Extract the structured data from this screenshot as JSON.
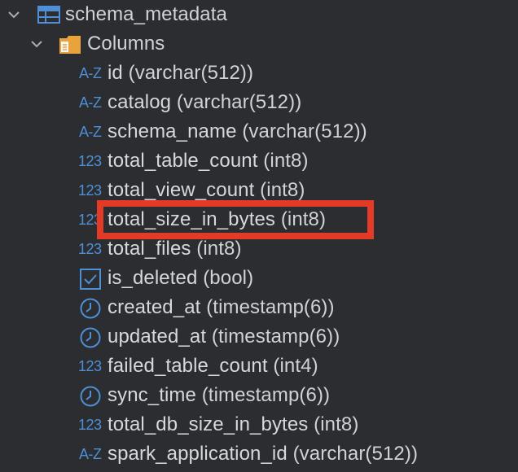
{
  "tree": {
    "table": {
      "name": "schema_metadata",
      "icon": "table-icon",
      "expanded": true
    },
    "folder": {
      "name": "Columns",
      "icon": "folder-icon",
      "expanded": true
    },
    "columns": [
      {
        "name": "id",
        "type": "(varchar(512))",
        "icon": "text-type-icon",
        "icon_text": "AZ"
      },
      {
        "name": "catalog",
        "type": "(varchar(512))",
        "icon": "text-type-icon",
        "icon_text": "AZ"
      },
      {
        "name": "schema_name",
        "type": "(varchar(512))",
        "icon": "text-type-icon",
        "icon_text": "AZ"
      },
      {
        "name": "total_table_count",
        "type": "(int8)",
        "icon": "numeric-type-icon",
        "icon_text": "123"
      },
      {
        "name": "total_view_count",
        "type": "(int8)",
        "icon": "numeric-type-icon",
        "icon_text": "123"
      },
      {
        "name": "total_size_in_bytes",
        "type": "(int8)",
        "icon": "numeric-type-icon",
        "icon_text": "123"
      },
      {
        "name": "total_files",
        "type": "(int8)",
        "icon": "numeric-type-icon",
        "icon_text": "123"
      },
      {
        "name": "is_deleted",
        "type": "(bool)",
        "icon": "boolean-type-icon",
        "icon_text": ""
      },
      {
        "name": "created_at",
        "type": "(timestamp(6))",
        "icon": "timestamp-type-icon",
        "icon_text": ""
      },
      {
        "name": "updated_at",
        "type": "(timestamp(6))",
        "icon": "timestamp-type-icon",
        "icon_text": ""
      },
      {
        "name": "failed_table_count",
        "type": "(int4)",
        "icon": "numeric-type-icon",
        "icon_text": "123"
      },
      {
        "name": "sync_time",
        "type": "(timestamp(6))",
        "icon": "timestamp-type-icon",
        "icon_text": ""
      },
      {
        "name": "total_db_size_in_bytes",
        "type": "(int8)",
        "icon": "numeric-type-icon",
        "icon_text": "123"
      },
      {
        "name": "spark_application_id",
        "type": "(varchar(512))",
        "icon": "text-type-icon",
        "icon_text": "AZ"
      }
    ]
  },
  "colors": {
    "background": "#2b2d30",
    "icon_blue": "#4f8fd6",
    "folder_orange": "#e8a33c",
    "highlight_red": "#e43b26"
  }
}
